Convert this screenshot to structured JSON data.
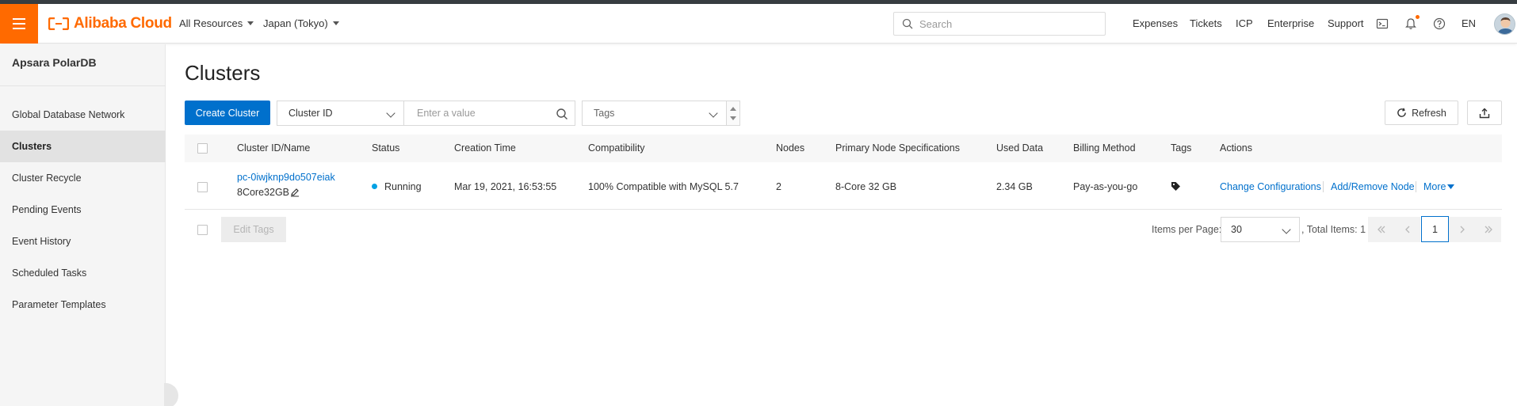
{
  "header": {
    "brand": "Alibaba Cloud",
    "resources_label": "All Resources",
    "region_label": "Japan (Tokyo)",
    "search_placeholder": "Search",
    "links": [
      "Expenses",
      "Tickets",
      "ICP",
      "Enterprise",
      "Support"
    ],
    "language": "EN"
  },
  "sidebar": {
    "title": "Apsara PolarDB",
    "items": [
      {
        "label": "Global Database Network"
      },
      {
        "label": "Clusters"
      },
      {
        "label": "Cluster Recycle"
      },
      {
        "label": "Pending Events"
      },
      {
        "label": "Event History"
      },
      {
        "label": "Scheduled Tasks"
      },
      {
        "label": "Parameter Templates"
      }
    ],
    "active_item": "Clusters"
  },
  "main": {
    "title": "Clusters",
    "toolbar": {
      "create_label": "Create Cluster",
      "filter_field": "Cluster ID",
      "value_placeholder": "Enter a value",
      "tags_label": "Tags",
      "refresh_label": "Refresh"
    },
    "table": {
      "columns": [
        "Cluster ID/Name",
        "Status",
        "Creation Time",
        "Compatibility",
        "Nodes",
        "Primary Node Specifications",
        "Used Data",
        "Billing Method",
        "Tags",
        "Actions"
      ],
      "rows": [
        {
          "cluster_id": "pc-0iwjknp9do507eiak",
          "cluster_name": "8Core32GB",
          "status": "Running",
          "creation_time": "Mar 19, 2021, 16:53:55",
          "compatibility": "100% Compatible with MySQL 5.7",
          "nodes": "2",
          "spec": "8-Core 32 GB",
          "used_data": "2.34 GB",
          "billing": "Pay-as-you-go",
          "actions": [
            "Change Configurations",
            "Add/Remove Node",
            "More"
          ]
        }
      ]
    },
    "footer": {
      "edit_tags_label": "Edit Tags",
      "items_per_page_label": "Items per Page:",
      "items_per_page_value": "30",
      "total_label": ", Total Items: 1",
      "current_page": "1"
    }
  },
  "colors": {
    "brand_orange": "#ff6a00",
    "primary_blue": "#0070cc",
    "running_dot": "#00a1e4"
  },
  "icons": [
    "menu-icon",
    "alibaba-logo-icon",
    "search-icon",
    "terminal-icon",
    "bell-icon",
    "help-icon",
    "refresh-icon",
    "export-icon",
    "edit-icon",
    "tag-icon",
    "chevron-down-icon"
  ]
}
